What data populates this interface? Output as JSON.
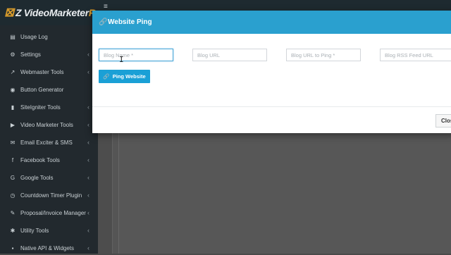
{
  "app": {
    "logo_mark": "⊠",
    "logo_main": "Z Video",
    "logo_accent": " Marketer",
    "logo_tail": " R",
    "menu_icon": "≡"
  },
  "sidebar": {
    "items": [
      {
        "label": "Usage Log",
        "icon": "▤",
        "chevron": ""
      },
      {
        "label": "Settings",
        "icon": "⚙",
        "chevron": "‹"
      },
      {
        "label": "Webmaster Tools",
        "icon": "↗",
        "chevron": "‹"
      },
      {
        "label": "Button Generator",
        "icon": "◉",
        "chevron": ""
      },
      {
        "label": "SiteIgniter Tools",
        "icon": "▮",
        "chevron": "‹"
      },
      {
        "label": "Video Marketer Tools",
        "icon": "▶",
        "chevron": "‹"
      },
      {
        "label": "Email Exciter & SMS",
        "icon": "✉",
        "chevron": "‹"
      },
      {
        "label": "Facebook Tools",
        "icon": "f",
        "chevron": "‹"
      },
      {
        "label": "Google Tools",
        "icon": "G",
        "chevron": "‹"
      },
      {
        "label": "Countdown Timer Plugin",
        "icon": "◷",
        "chevron": "‹"
      },
      {
        "label": "Proposal/Invoice Manager",
        "icon": "✎",
        "chevron": "‹"
      },
      {
        "label": "Utility Tools",
        "icon": "✱",
        "chevron": "‹"
      },
      {
        "label": "Native API & Widgets",
        "icon": "▪",
        "chevron": "‹"
      }
    ]
  },
  "modal": {
    "title": "Website Ping",
    "title_icon": "🔗",
    "fields": {
      "blog_name": {
        "placeholder": "Blog Name *",
        "value": ""
      },
      "blog_url": {
        "placeholder": "Blog URL",
        "value": ""
      },
      "blog_url_to_ping": {
        "placeholder": "Blog URL to Ping *",
        "value": ""
      },
      "blog_rss_feed_url": {
        "placeholder": "Blog RSS Feed URL",
        "value": ""
      }
    },
    "ping_button": {
      "label": "Ping Website",
      "icon": "🔗"
    },
    "close_button": {
      "label": "Close"
    },
    "text_cursor": "I"
  },
  "colors": {
    "modal_header": "#2aa0cf",
    "primary_button": "#1aa0d6",
    "sidebar_bg": "#22292e",
    "topbar_bg": "#1e2a30"
  }
}
